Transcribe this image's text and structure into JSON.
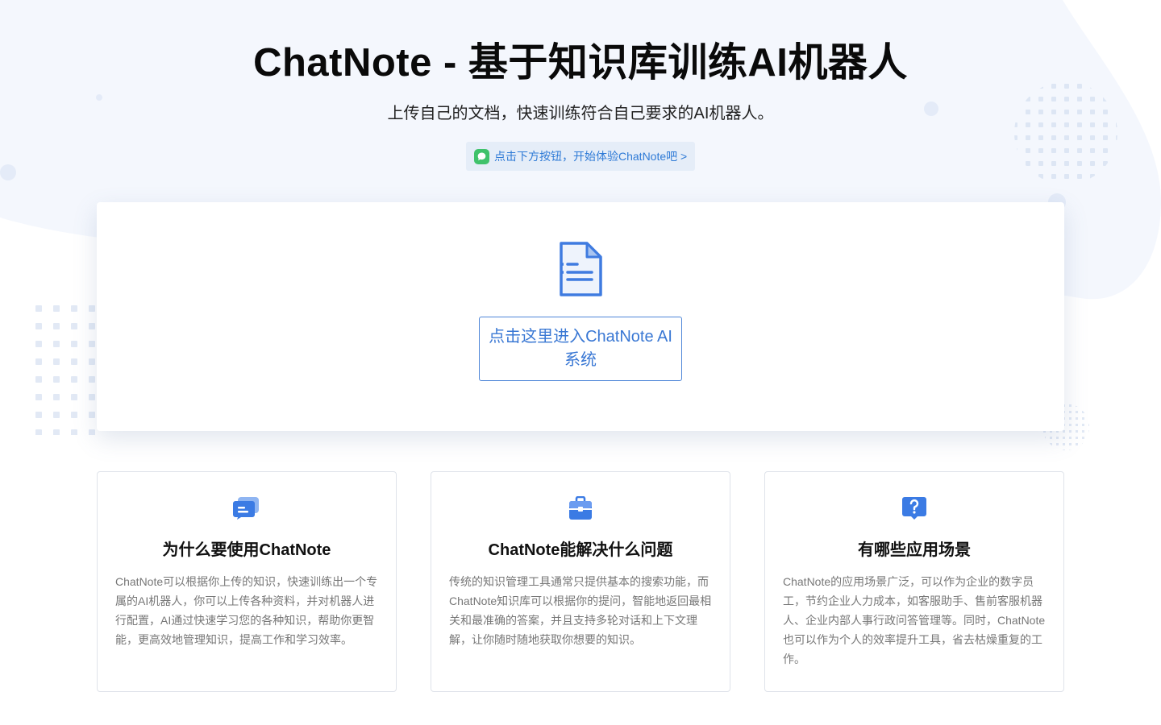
{
  "hero": {
    "title": "ChatNote - 基于知识库训练AI机器人",
    "subtitle": "上传自己的文档，快速训练符合自己要求的AI机器人。",
    "hint": "点击下方按钮，开始体验ChatNote吧 >"
  },
  "main": {
    "enter_button": "点击这里进入ChatNote AI系统"
  },
  "features": [
    {
      "icon": "chat-bubbles-icon",
      "title": "为什么要使用ChatNote",
      "desc": "ChatNote可以根据你上传的知识，快速训练出一个专属的AI机器人，你可以上传各种资料，并对机器人进行配置，AI通过快速学习您的各种知识，帮助你更智能，更高效地管理知识，提高工作和学习效率。"
    },
    {
      "icon": "briefcase-icon",
      "title": "ChatNote能解决什么问题",
      "desc": "传统的知识管理工具通常只提供基本的搜索功能，而ChatNote知识库可以根据你的提问，智能地返回最相关和最准确的答案，并且支持多轮对话和上下文理解，让你随时随地获取你想要的知识。"
    },
    {
      "icon": "question-icon",
      "title": "有哪些应用场景",
      "desc": "ChatNote的应用场景广泛，可以作为企业的数字员工，节约企业人力成本，如客服助手、售前客服机器人、企业内部人事行政问答管理等。同时，ChatNote也可以作为个人的效率提升工具，省去枯燥重复的工作。"
    }
  ],
  "colors": {
    "accent": "#3a78d4",
    "hint_bg": "#e5edf8",
    "chat_green": "#3fc26b",
    "page_bg_tint": "#f3f7fd"
  }
}
